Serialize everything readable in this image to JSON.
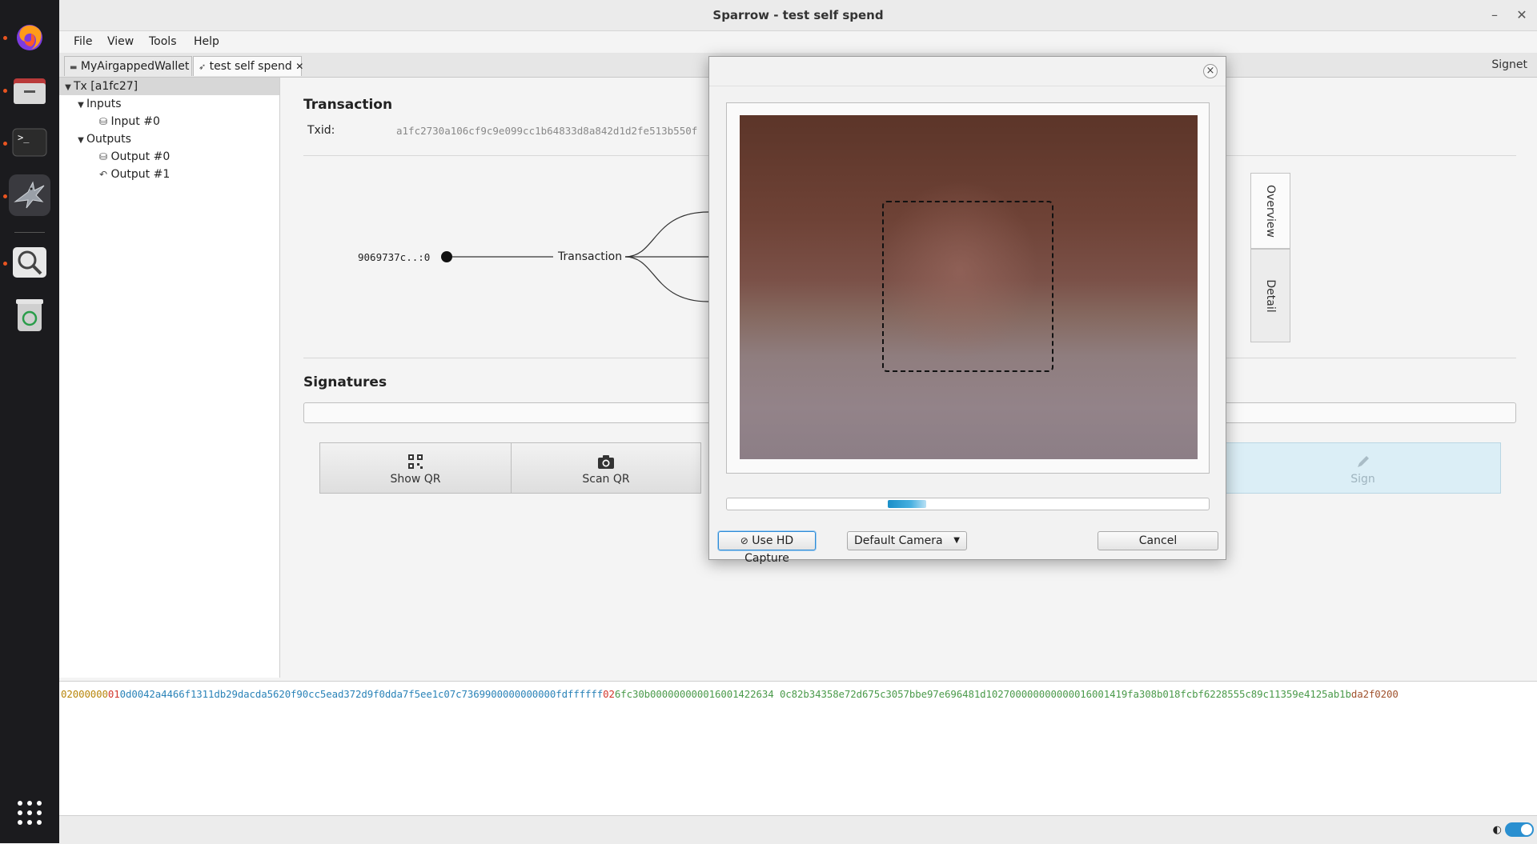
{
  "window": {
    "title": "Sparrow - test self spend",
    "minimize": "–",
    "close": "✕"
  },
  "menu": [
    "File",
    "View",
    "Tools",
    "Help"
  ],
  "tabs": [
    {
      "label": "MyAirgappedWallet",
      "icon": "wallet-icon"
    },
    {
      "label": "test self spend",
      "icon": "send-icon",
      "close": "✕"
    }
  ],
  "network": "Signet",
  "tree": {
    "root": "Tx [a1fc27]",
    "inputs": "Inputs",
    "input0": "Input #0",
    "outputs": "Outputs",
    "output0": "Output #0",
    "output1": "Output #1"
  },
  "transaction": {
    "heading": "Transaction",
    "txid_label": "Txid:",
    "txid": "a1fc2730a106cf9c9e099cc1b64833d8a842d1d2fe513b550f",
    "input_ref": "9069737c..:0",
    "node_label": "Transaction"
  },
  "side_tabs": {
    "overview": "Overview",
    "detail": "Detail"
  },
  "signatures": {
    "heading": "Signatures",
    "show_qr": "Show QR",
    "scan_qr": "Scan QR",
    "sign": "Sign"
  },
  "hex": {
    "version": "02000000",
    "marker": "01",
    "inputs": "0d0042a4466f1311db29dacda5620f90cc5ead372d9f0dda7f5ee1c07c7369900000000000fdffffff",
    "outcount": "02",
    "outputs": "6fc30b000000000016001422634 0c82b34358e72d675c3057bbe97e696481d102700000000000016001419fa308b018fcbf6228555c89c11359e4125ab1b",
    "locktime": "da2f0200"
  },
  "dialog": {
    "close": "×",
    "progress_fraction": 0.08,
    "use_hd_capture": "Use HD Capture",
    "camera": "Default Camera",
    "cancel": "Cancel"
  },
  "dock": [
    "firefox-icon",
    "files-icon",
    "terminal-icon",
    "sparrow-icon",
    "search-icon",
    "trash-icon",
    "apps-grid-icon"
  ],
  "colors": {
    "hex_version": "#b8860b",
    "hex_marker": "#d2362c",
    "hex_inputs": "#2a83b8",
    "hex_outputs": "#4a9a4a",
    "hex_locktime": "#a0522d",
    "progress": "#1a8fc8"
  }
}
